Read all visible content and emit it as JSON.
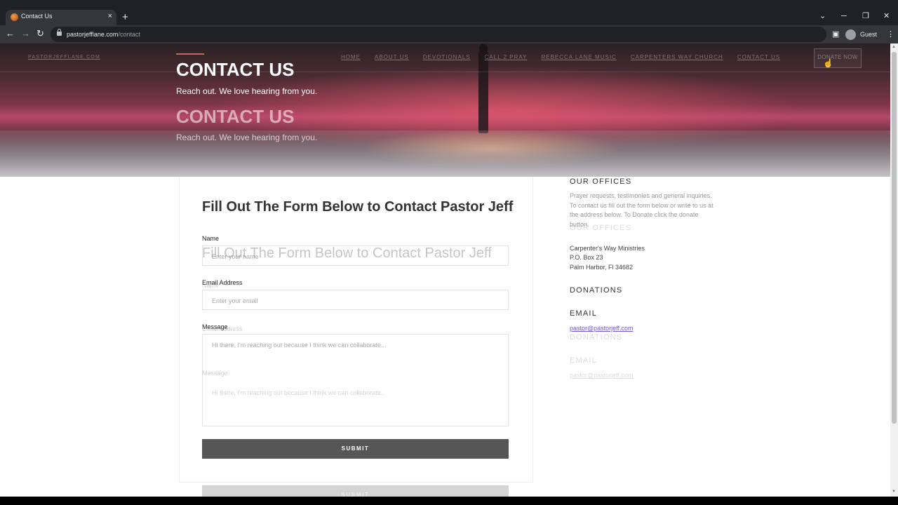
{
  "browser": {
    "tab_title": "Contact Us",
    "tab_close": "×",
    "new_tab": "+",
    "url_domain": "pastorjefflane.com",
    "url_path": "/contact",
    "profile_label": "Guest",
    "back": "←",
    "forward": "→",
    "reload": "↻",
    "minimize": "─",
    "restore": "❐",
    "close": "✕",
    "tab_search": "⌄",
    "menu": "⋮",
    "sidebar": "▣"
  },
  "site": {
    "logo": "PASTORJEFFLANE.COM",
    "nav": [
      "HOME",
      "ABOUT US",
      "DEVOTIONALS",
      "CALL 2 PRAY",
      "REBECCA LANE MUSIC",
      "CARPENTERS WAY CHURCH",
      "CONTACT US"
    ],
    "donate": "DONATE NOW"
  },
  "hero": {
    "title": "CONTACT US",
    "subtitle": "Reach out. We love hearing from you."
  },
  "form": {
    "heading": "Fill Out The Form Below to Contact Pastor Jeff",
    "name_label": "Name",
    "name_placeholder": "Enter your name",
    "email_label": "Email Address",
    "email_placeholder": "Enter your email",
    "message_label": "Message",
    "message_placeholder": "Hi there, I'm reaching out because I think we can collaborate...",
    "submit": "SUBMIT"
  },
  "sidebar": {
    "offices_title": "OUR OFFICES",
    "offices_text": "Prayer requests, testimonies and general inquiries.  To contact us fill out the form below or write to us at the address below.  To Donate click the donate button.",
    "address_line1": "Carpenter's Way Ministries",
    "address_line2": "P.O. Box 23",
    "address_line3": "Palm Harbor, Fl 34682",
    "donations_title": "DONATIONS",
    "email_title": "EMAIL",
    "email": "pastor@pastorjeff.com"
  }
}
